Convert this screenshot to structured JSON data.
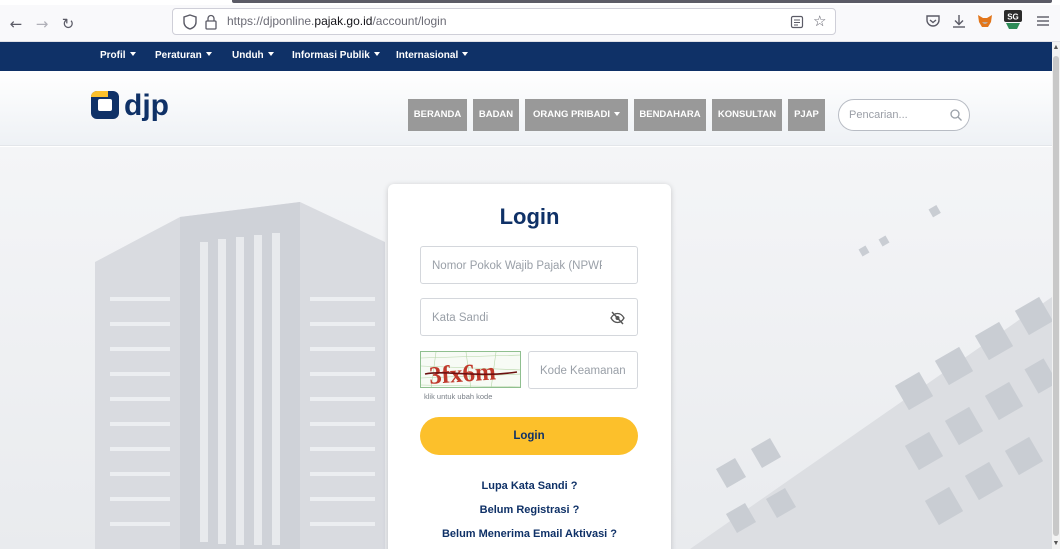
{
  "browser": {
    "url_prefix": "https://djponline.",
    "url_domain": "pajak.go.id",
    "url_suffix": "/account/login"
  },
  "topnav": {
    "items": [
      "Profil",
      "Peraturan",
      "Unduh",
      "Informasi Publik",
      "Internasional"
    ]
  },
  "header": {
    "logo_text": "djp",
    "menu": [
      "BERANDA",
      "BADAN",
      "ORANG PRIBADI",
      "BENDAHARA",
      "KONSULTAN",
      "PJAP"
    ],
    "search_placeholder": "Pencarian..."
  },
  "login": {
    "title": "Login",
    "npwp_placeholder": "Nomor Pokok Wajib Pajak (NPWP)",
    "password_placeholder": "Kata Sandi",
    "captcha_text": "3fx6m",
    "captcha_placeholder": "Kode Keamanan",
    "captcha_hint": "klik untuk ubah kode",
    "submit_label": "Login",
    "forgot_link": "Lupa Kata Sandi ?",
    "register_link": "Belum Registrasi ?",
    "activation_link": "Belum Menerima Email Aktivasi ?"
  },
  "colors": {
    "navy": "#0f3167",
    "accent_yellow": "#fcc02b",
    "menu_grey": "#999999"
  }
}
